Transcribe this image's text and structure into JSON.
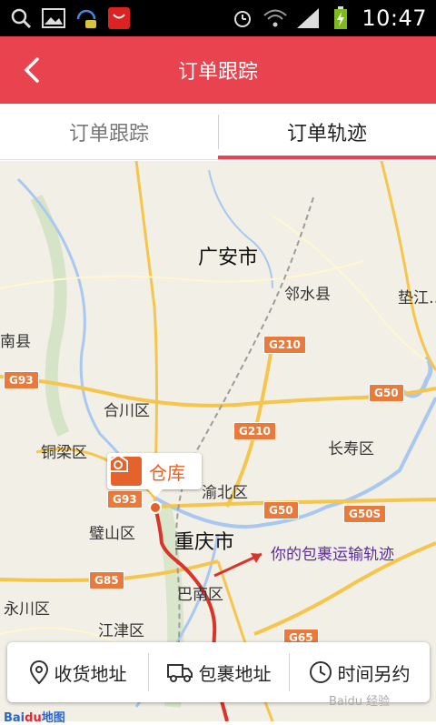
{
  "status_bar": {
    "time": "10:47"
  },
  "header": {
    "title": "订单跟踪"
  },
  "tabs": [
    {
      "label": "订单跟踪",
      "active": false
    },
    {
      "label": "订单轨迹",
      "active": true
    }
  ],
  "map": {
    "cities": {
      "guangan": "广安市",
      "linshui": "邻水县",
      "dianjiang": "垫江…",
      "nanxian": "南县",
      "hechuan": "合川区",
      "tongliang": "铜梁区",
      "changshou": "长寿区",
      "yubei": "渝北区",
      "bishan": "璧山区",
      "chongqing": "重庆市",
      "banan": "巴南区",
      "yongchuan": "永川区",
      "jiangjin": "江津区"
    },
    "road_shields": {
      "g210a": "G210",
      "g93a": "G93",
      "g50a": "G50",
      "g210b": "G210",
      "g93b": "G93",
      "g50b": "G50",
      "g50s": "G50S",
      "g85": "G85",
      "g65": "G65"
    },
    "warehouse_label": "仓库",
    "annotation": "你的包裹运输轨迹",
    "logo_bai": "Bai",
    "logo_du": "du",
    "logo_cn": "地图",
    "watermark": "Baidu 经验"
  },
  "bottom_bar": [
    {
      "label": "收货地址",
      "icon": "location-pin-icon"
    },
    {
      "label": "包裹地址",
      "icon": "delivery-truck-icon"
    },
    {
      "label": "时间另约",
      "icon": "clock-icon"
    }
  ],
  "colors": {
    "accent": "#e8434e",
    "route": "#d9342b",
    "warehouse": "#e5632a",
    "annotation": "#5b2ca0"
  }
}
